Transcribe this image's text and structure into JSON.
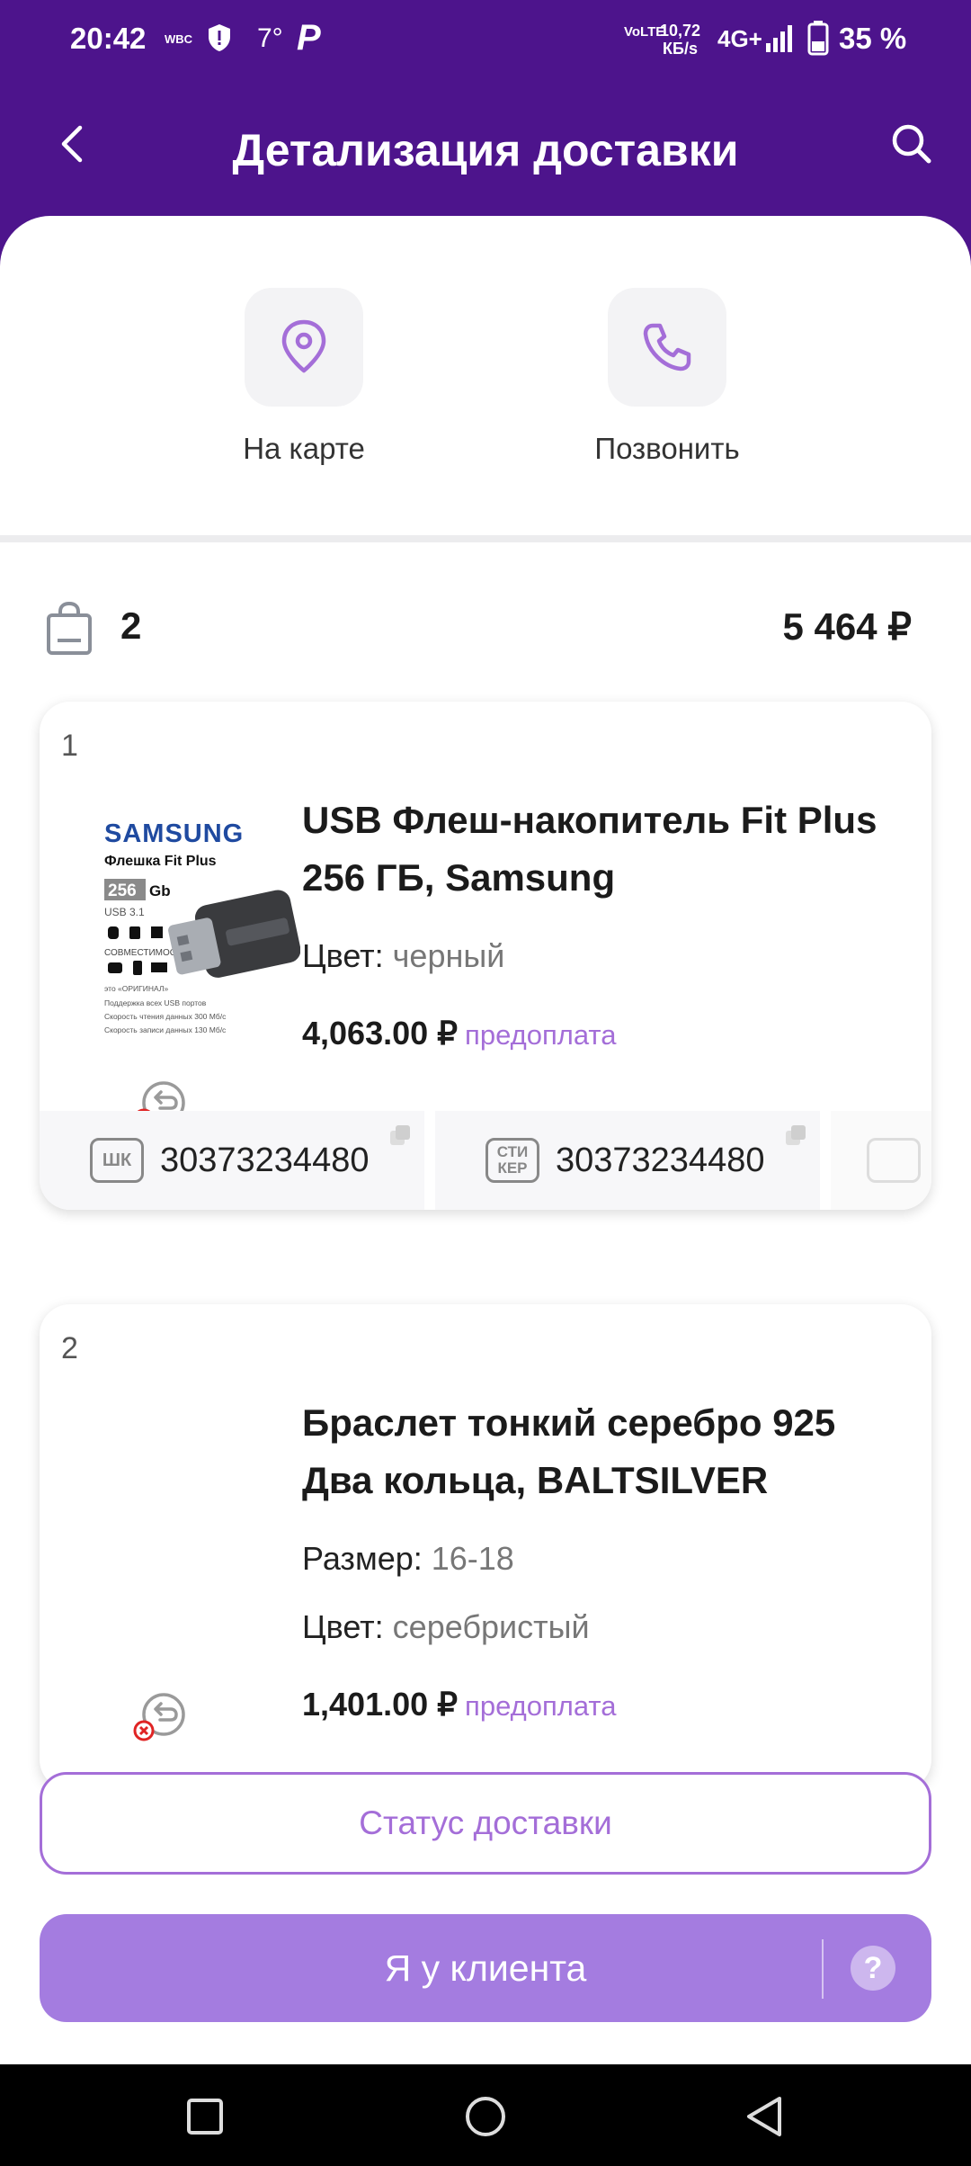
{
  "status_bar": {
    "time": "20:42",
    "carrier_tag": "WBC",
    "temperature": "7°",
    "volte": "VoLTE",
    "speed_value": "10,72",
    "speed_unit": "КБ/s",
    "network": "4G+",
    "battery": "35 %"
  },
  "header": {
    "title": "Детализация доставки"
  },
  "actions": {
    "map_label": "На карте",
    "call_label": "Позвонить"
  },
  "summary": {
    "count": "2",
    "total": "5 464 ₽"
  },
  "items": [
    {
      "index": "1",
      "name": "USB Флеш-накопитель Fit Plus 256 ГБ, Samsung",
      "color_label": "Цвет: ",
      "color_value": "черный",
      "price": "4,063.00 ₽",
      "payment": "предоплата",
      "thumb": {
        "brand": "SAMSUNG",
        "product": "Флешка Fit Plus",
        "capacity": "256",
        "capacity_unit": "Gb",
        "usb": "USB 3.1",
        "compat": "СОВМЕСТИМОСТЬ",
        "line1": "это «ОРИГИНАЛ»",
        "line2": "Поддержка всех USB портов",
        "line3": "Скорость чтения данных 300 Мб/с",
        "line4": "Скорость записи данных 130 Мб/с"
      },
      "codes": [
        {
          "icon": "ШК",
          "value": "30373234480"
        },
        {
          "icon": "СТИ КЕР",
          "value": "30373234480"
        }
      ]
    },
    {
      "index": "2",
      "name": "Браслет тонкий серебро 925 Два кольца, BALTSILVER",
      "size_label": "Размер: ",
      "size_value": "16-18",
      "color_label": "Цвет: ",
      "color_value": "серебристый",
      "price": "1,401.00 ₽",
      "payment": "предоплата"
    }
  ],
  "buttons": {
    "status": "Статус доставки",
    "at_client": "Я у клиента",
    "help": "?"
  },
  "colors": {
    "brand": "#4d148c",
    "accent": "#a46ed8",
    "primary_button": "#a47ce0"
  }
}
